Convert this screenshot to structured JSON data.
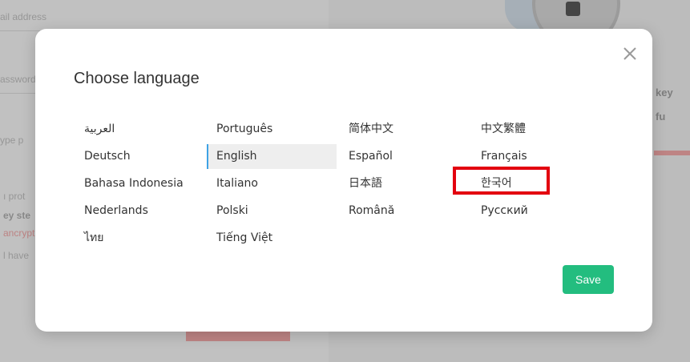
{
  "background": {
    "email_label": "ail address",
    "password_label": "assword",
    "type_label": "ype p",
    "right_label_1": "key",
    "right_label_2": "fu",
    "left_label_a": "ı prot",
    "left_label_b": "ey ste",
    "left_label_c": "ancrypt",
    "left_label_d": "l have"
  },
  "modal": {
    "title": "Choose language",
    "close_icon": "close-icon",
    "languages": [
      [
        "العربية",
        "Português",
        "简体中文",
        "中文繁體"
      ],
      [
        "Deutsch",
        "English",
        "Español",
        "Français"
      ],
      [
        "Bahasa Indonesia",
        "Italiano",
        "日本語",
        "한국어"
      ],
      [
        "Nederlands",
        "Polski",
        "Română",
        "Русский"
      ],
      [
        "ไทย",
        "Tiếng Việt",
        "",
        ""
      ]
    ],
    "selected_language": "English",
    "highlighted_language": "한국어",
    "save_label": "Save"
  },
  "colors": {
    "accent": "#23bd7f",
    "selected_border": "#3ea2e5",
    "highlight": "#e3000f"
  }
}
